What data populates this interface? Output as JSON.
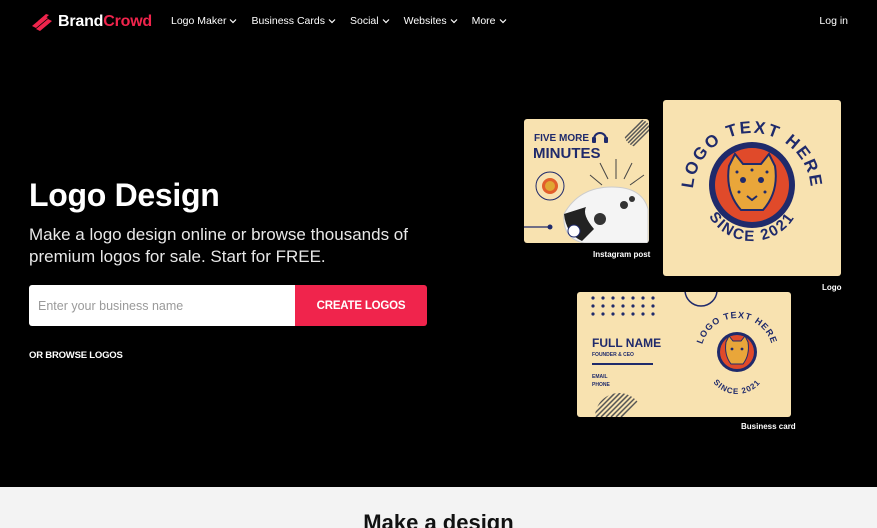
{
  "brand": {
    "part1": "Brand",
    "part2": "Crowd"
  },
  "nav": {
    "items": [
      {
        "label": "Logo Maker"
      },
      {
        "label": "Business Cards"
      },
      {
        "label": "Social"
      },
      {
        "label": "Websites"
      },
      {
        "label": "More"
      }
    ],
    "login": "Log in"
  },
  "hero": {
    "title": "Logo Design",
    "subtitle": "Make a logo design online or browse thousands of premium logos for sale. Start for FREE.",
    "input_placeholder": "Enter your business name",
    "cta": "CREATE LOGOS",
    "browse": "OR BROWSE LOGOS"
  },
  "cards": {
    "instagram": {
      "line1": "FIVE MORE",
      "line2": "MINUTES",
      "caption": "Instagram post"
    },
    "logo": {
      "top_text": "LOGO TEXT HERE",
      "bottom_text": "SINCE 2021",
      "caption": "Logo"
    },
    "business": {
      "name": "FULL NAME",
      "role": "FOUNDER & CEO",
      "email": "EMAIL",
      "phone": "PHONE",
      "top_text": "LOGO TEXT HERE",
      "bottom_text": "SINCE 2021",
      "caption": "Business card"
    }
  },
  "section": {
    "title": "Make a design"
  },
  "colors": {
    "accent": "#f0244c",
    "card": "#f8e2b0",
    "navy": "#1f2a6b"
  }
}
